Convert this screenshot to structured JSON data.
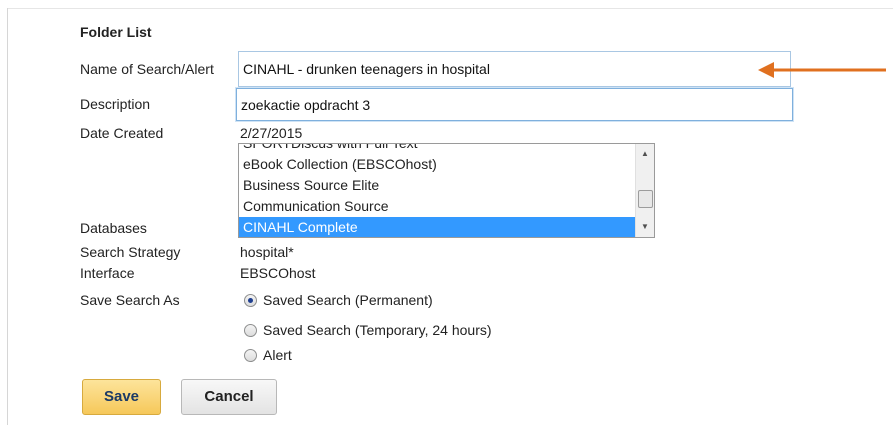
{
  "heading": "Folder List",
  "form": {
    "name_label": "Name of Search/Alert",
    "name_value": "CINAHL - drunken teenagers in hospital",
    "description_label": "Description",
    "description_value": "zoekactie opdracht 3",
    "date_label": "Date Created",
    "date_value": "2/27/2015",
    "databases_label": "Databases",
    "databases_options": [
      "SPORTDiscus with Full Text",
      "eBook Collection (EBSCOhost)",
      "Business Source Elite",
      "Communication Source",
      "CINAHL Complete"
    ],
    "databases_selected": "CINAHL Complete",
    "strategy_label": "Search Strategy",
    "strategy_value": "hospital*",
    "interface_label": "Interface",
    "interface_value": "EBSCOhost",
    "save_as_label": "Save Search As",
    "save_as_options": [
      "Saved Search (Permanent)",
      "Saved Search (Temporary, 24 hours)",
      "Alert"
    ],
    "save_as_selected": "Saved Search (Permanent)"
  },
  "buttons": {
    "save": "Save",
    "cancel": "Cancel"
  },
  "colors": {
    "selection": "#3399ff",
    "arrow": "#e0701f",
    "save_button": "#f6c85a"
  },
  "icons": {
    "annotation": "arrow-left-icon",
    "scroll_up": "triangle-up-icon",
    "scroll_down": "triangle-down-icon"
  }
}
